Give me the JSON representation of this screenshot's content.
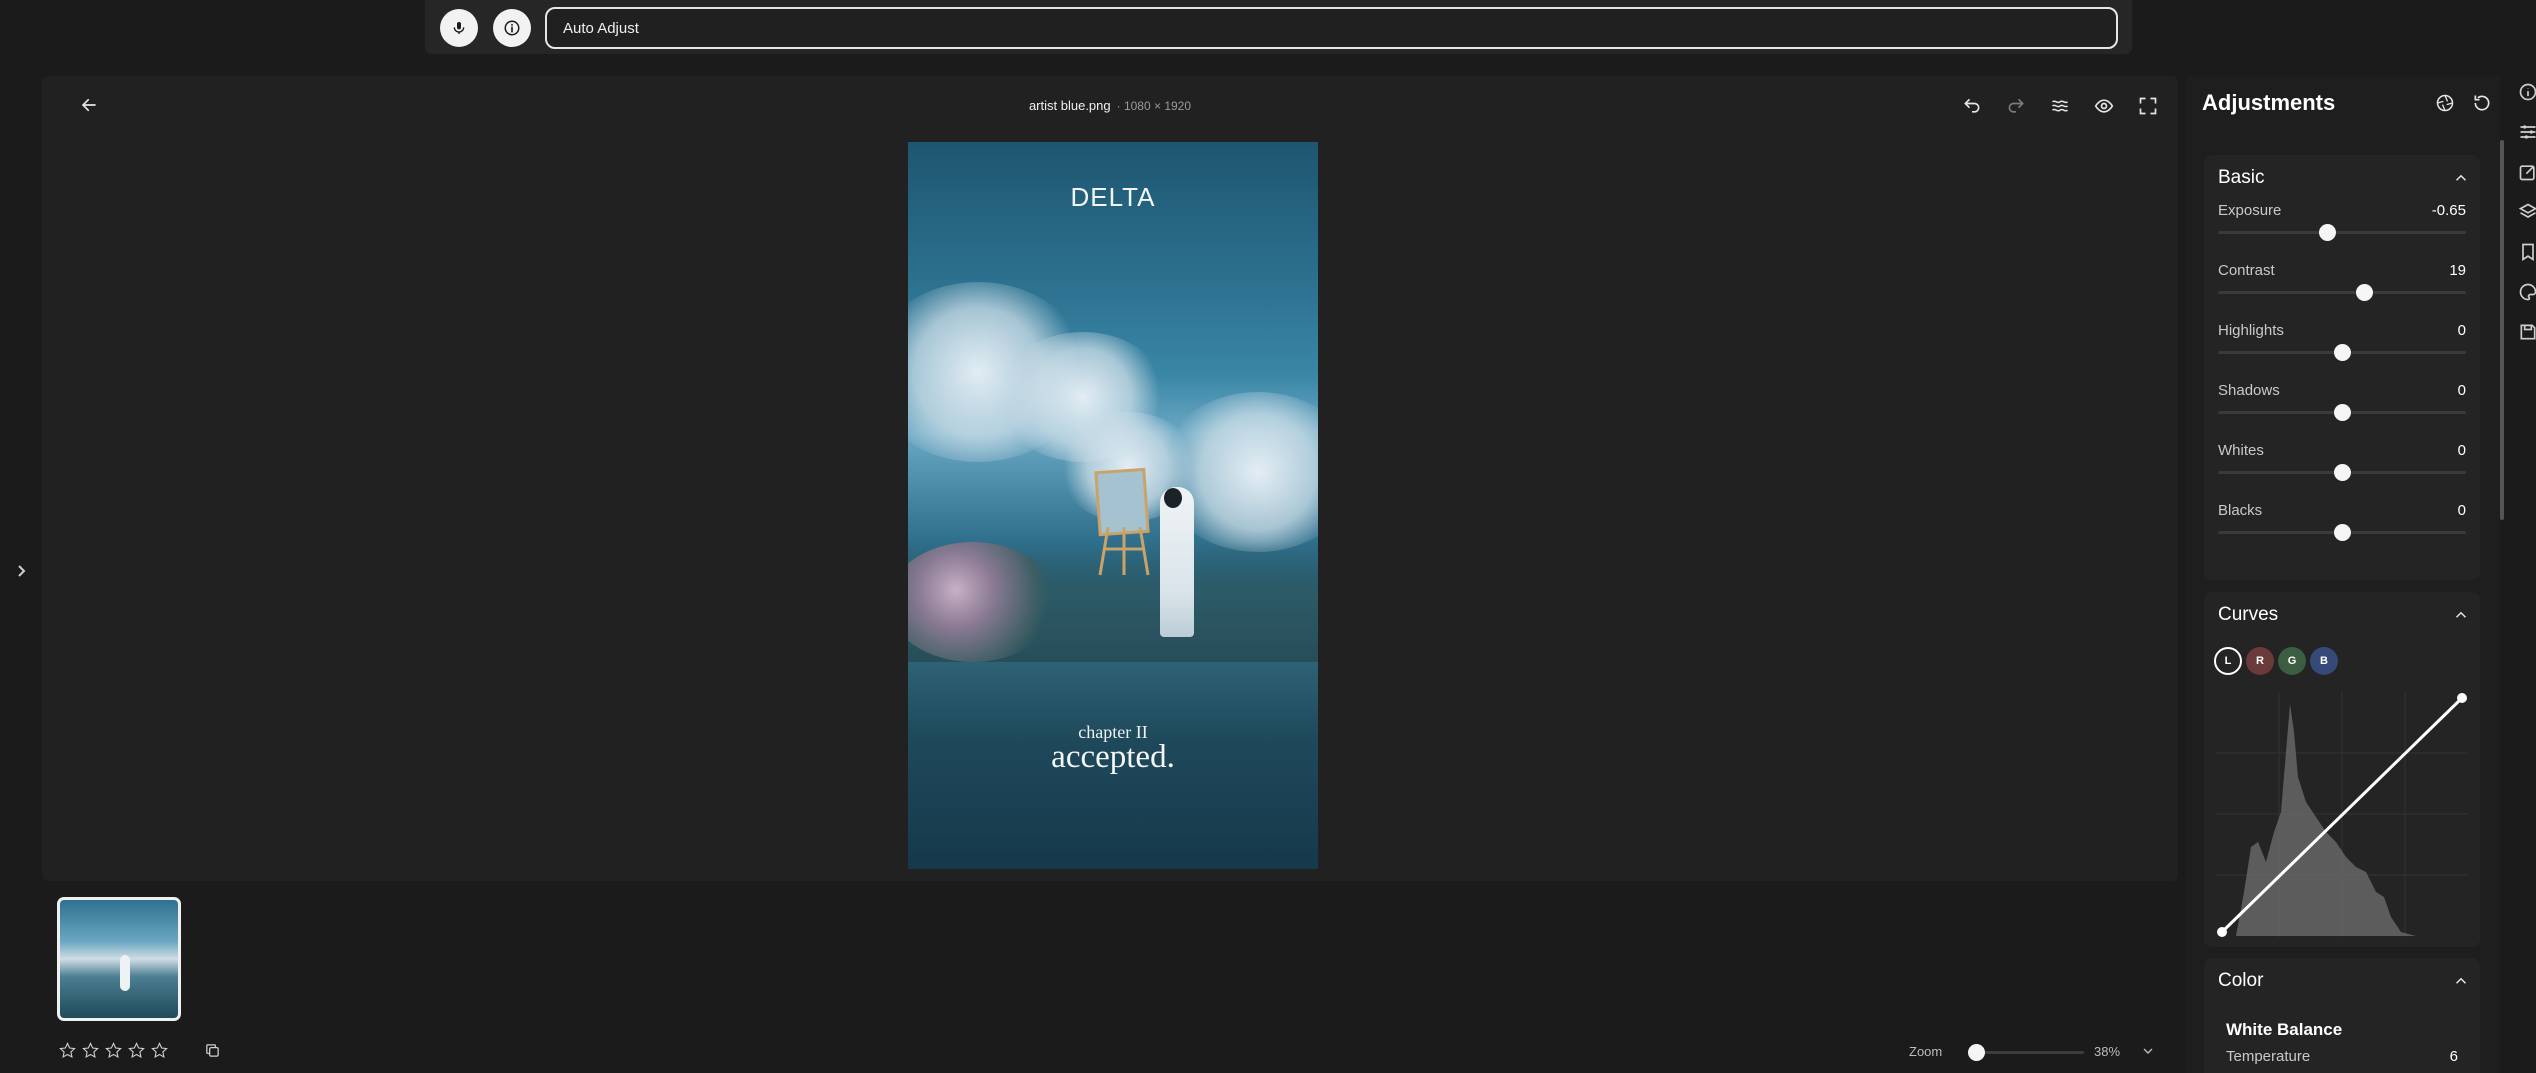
{
  "command_bar": {
    "input_value": "Auto Adjust"
  },
  "editor": {
    "file_name": "artist blue.png",
    "dimensions": "· 1080 × 1920",
    "image_text": {
      "top": "DELTA",
      "chapter": "chapter II",
      "tagline": "accepted."
    }
  },
  "filmstrip": {
    "rating_stars": 0,
    "zoom_label": "Zoom",
    "zoom_value": "38%",
    "zoom_level": 0.38
  },
  "adjustments": {
    "title": "Adjustments",
    "basic": {
      "heading": "Basic",
      "sliders": [
        {
          "label": "Exposure",
          "value": "-0.65",
          "position": 0.44
        },
        {
          "label": "Contrast",
          "value": "19",
          "position": 0.59
        },
        {
          "label": "Highlights",
          "value": "0",
          "position": 0.5
        },
        {
          "label": "Shadows",
          "value": "0",
          "position": 0.5
        },
        {
          "label": "Whites",
          "value": "0",
          "position": 0.5
        },
        {
          "label": "Blacks",
          "value": "0",
          "position": 0.5
        }
      ]
    },
    "curves": {
      "heading": "Curves",
      "channels": [
        "L",
        "R",
        "G",
        "B"
      ]
    },
    "color": {
      "heading": "Color",
      "white_balance": "White Balance",
      "temperature_label": "Temperature",
      "temperature_value": "6"
    }
  },
  "colors": {
    "background": "#1b1b1b",
    "panel": "#242424",
    "accent": "#ffffff"
  }
}
